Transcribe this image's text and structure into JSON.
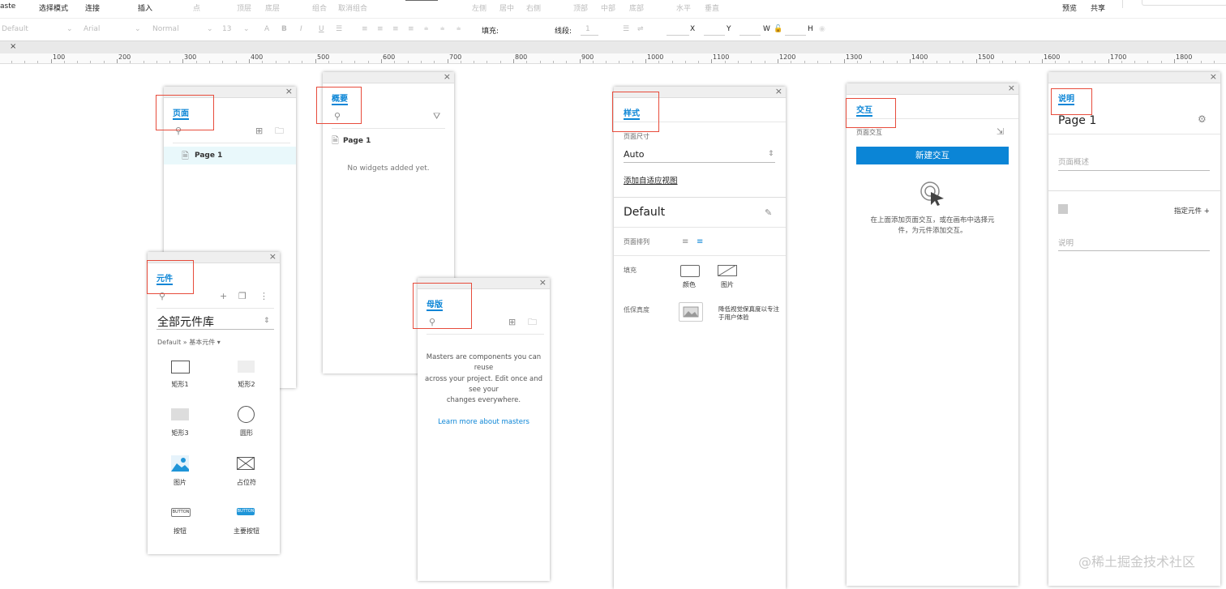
{
  "topbar": {
    "left_cut": "aste",
    "items": [
      "选择模式",
      "连接",
      "插入",
      "点",
      "顶层",
      "底层",
      "组合",
      "取消组合",
      "左侧",
      "居中",
      "右侧",
      "顶部",
      "中部",
      "底部",
      "水平",
      "垂直"
    ],
    "preview": "预览",
    "share": "共享"
  },
  "formatbar": {
    "style_select": "Default",
    "font_select": "Arial",
    "weight_select": "Normal",
    "size_select": "13",
    "fill_label": "填充:",
    "stroke_label": "线段:",
    "stroke_value": "1",
    "x": "X",
    "y": "Y",
    "w": "W",
    "h": "H"
  },
  "tabstrip": {
    "close": "×"
  },
  "ruler": {
    "labels": [
      "100",
      "200",
      "300",
      "400",
      "500",
      "600",
      "700",
      "800",
      "900",
      "1000",
      "1100",
      "1200",
      "1300",
      "1400",
      "1500",
      "1600",
      "1700",
      "1800"
    ]
  },
  "pages_panel": {
    "tab": "页面",
    "items": [
      "Page 1"
    ]
  },
  "widgets_panel": {
    "tab": "元件",
    "library": "全部元件库",
    "sub": "Default » 基本元件 ▾",
    "widgets": [
      "矩形1",
      "矩形2",
      "矩形3",
      "圆形",
      "图片",
      "占位符",
      "按钮",
      "主要按钮"
    ],
    "button_text": "BUTTON"
  },
  "outline_panel": {
    "tab": "概要",
    "page": "Page 1",
    "empty": "No widgets added yet."
  },
  "masters_panel": {
    "tab": "母版",
    "desc1": "Masters are components you can",
    "desc2": "reuse",
    "desc3": "across your project. Edit once and",
    "desc4": "see your",
    "desc5": "changes everywhere.",
    "link": "Learn more about masters"
  },
  "style_panel": {
    "tab": "样式",
    "page_size_label": "页面尺寸",
    "page_size_value": "Auto",
    "adaptive_link": "添加自适应视图",
    "style_name": "Default",
    "align_label": "页面排列",
    "fill_label": "填充",
    "fill_color": "颜色",
    "fill_image": "图片",
    "lowfi_label": "低保真度",
    "lowfi_desc1": "降低视觉保真度以专注",
    "lowfi_desc2": "于用户体验"
  },
  "interaction_panel": {
    "tab": "交互",
    "page_interaction": "页面交互",
    "new_button": "新建交互",
    "hint1": "在上面添加页面交互，或在画布中选择元",
    "hint2": "件，为元件添加交互。"
  },
  "notes_panel": {
    "tab": "说明",
    "page": "Page 1",
    "summary_placeholder": "页面概述",
    "assign_widget": "指定元件 +",
    "notes_placeholder": "说明"
  },
  "watermark": "@稀土掘金技术社区",
  "colors": {
    "accent": "#0b85d6",
    "highlight_box": "#e74c3c",
    "selected_row": "#e9f8fb"
  }
}
